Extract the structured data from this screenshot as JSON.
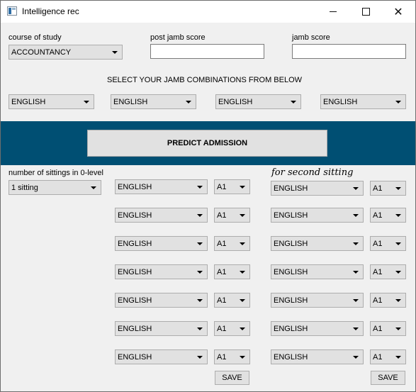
{
  "window": {
    "title": "Intelligence rec"
  },
  "top": {
    "course_label": "course of study",
    "course_value": "ACCOUNTANCY",
    "post_jamb_label": "post jamb score",
    "post_jamb_value": "",
    "jamb_label": "jamb score",
    "jamb_value": ""
  },
  "jamb": {
    "heading": "SELECT YOUR JAMB COMBINATIONS FROM BELOW",
    "subjects": [
      "ENGLISH",
      "ENGLISH",
      "ENGLISH",
      "ENGLISH"
    ]
  },
  "predict_label": "PREDICT ADMISSION",
  "olevel": {
    "sittings_label": "number of sittings in 0-level",
    "sittings_value": "1 sitting",
    "second_label": "for second sitting",
    "first": [
      {
        "subject": "ENGLISH",
        "grade": "A1"
      },
      {
        "subject": "ENGLISH",
        "grade": "A1"
      },
      {
        "subject": "ENGLISH",
        "grade": "A1"
      },
      {
        "subject": "ENGLISH",
        "grade": "A1"
      },
      {
        "subject": "ENGLISH",
        "grade": "A1"
      },
      {
        "subject": "ENGLISH",
        "grade": "A1"
      },
      {
        "subject": "ENGLISH",
        "grade": "A1"
      }
    ],
    "second": [
      {
        "subject": "ENGLISH",
        "grade": "A1"
      },
      {
        "subject": "ENGLISH",
        "grade": "A1"
      },
      {
        "subject": "ENGLISH",
        "grade": "A1"
      },
      {
        "subject": "ENGLISH",
        "grade": "A1"
      },
      {
        "subject": "ENGLISH",
        "grade": "A1"
      },
      {
        "subject": "ENGLISH",
        "grade": "A1"
      },
      {
        "subject": "ENGLISH",
        "grade": "A1"
      }
    ],
    "save_label": "SAVE",
    "save2_label": "SAVE"
  }
}
